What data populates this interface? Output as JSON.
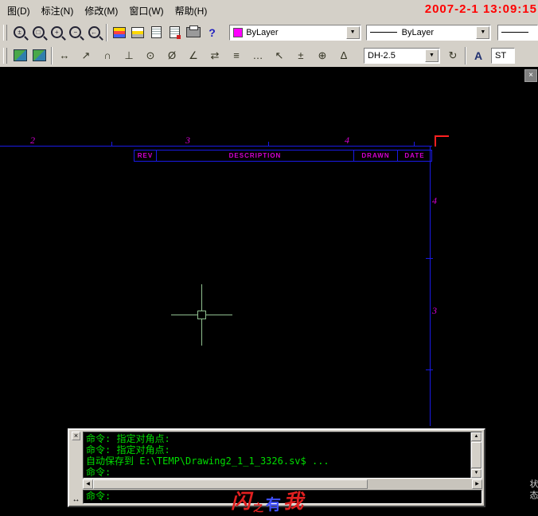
{
  "app": {
    "clock": "2007-2-1 13:09:15"
  },
  "menubar": {
    "items": [
      "图(D)",
      "标注(N)",
      "修改(M)",
      "窗口(W)",
      "帮助(H)"
    ]
  },
  "toolbar_standard": {
    "icons": [
      {
        "name": "zoom-realtime-icon",
        "glyph": "±"
      },
      {
        "name": "zoom-window-icon",
        "glyph": "□"
      },
      {
        "name": "zoom-in-icon",
        "glyph": "+"
      },
      {
        "name": "zoom-out-icon",
        "glyph": "−"
      },
      {
        "name": "zoom-previous-icon",
        "glyph": "←"
      },
      {
        "name": "layer-properties-icon",
        "glyph": ""
      },
      {
        "name": "layers-list-icon",
        "glyph": ""
      },
      {
        "name": "object-properties-icon",
        "glyph": ""
      },
      {
        "name": "match-properties-icon",
        "glyph": ""
      },
      {
        "name": "print-icon",
        "glyph": ""
      },
      {
        "name": "help-icon",
        "glyph": "?"
      }
    ],
    "color_combo": {
      "value": "ByLayer",
      "swatch_color": "#ff00ff"
    },
    "linetype_combo": {
      "value": "ByLayer"
    },
    "lineweight_combo": {
      "value": ""
    },
    "dropdown_arrow": "▼"
  },
  "toolbar_dimension": {
    "view_icons": [
      {
        "name": "sw-isometric-view-icon"
      },
      {
        "name": "se-isometric-view-icon"
      }
    ],
    "icons": [
      {
        "name": "linear-dimension-icon",
        "glyph": "↔"
      },
      {
        "name": "aligned-dimension-icon",
        "glyph": "↗"
      },
      {
        "name": "arc-length-dimension-icon",
        "glyph": "∩"
      },
      {
        "name": "ordinate-dimension-icon",
        "glyph": "⊥"
      },
      {
        "name": "radius-dimension-icon",
        "glyph": "⊙"
      },
      {
        "name": "diameter-dimension-icon",
        "glyph": "Ø"
      },
      {
        "name": "angular-dimension-icon",
        "glyph": "∠"
      },
      {
        "name": "quick-dimension-icon",
        "glyph": "⇄"
      },
      {
        "name": "baseline-dimension-icon",
        "glyph": "≡"
      },
      {
        "name": "continue-dimension-icon",
        "glyph": "…"
      },
      {
        "name": "quick-leader-icon",
        "glyph": "↖"
      },
      {
        "name": "tolerance-icon",
        "glyph": "±"
      },
      {
        "name": "center-mark-icon",
        "glyph": "⊕"
      },
      {
        "name": "dimension-edit-icon",
        "glyph": "Δ"
      },
      {
        "name": "dimension-update-icon",
        "glyph": "↻"
      }
    ],
    "dim_style_combo": {
      "value": "DH-2.5"
    },
    "text_style_icon_glyph": "A",
    "text_style_combo": {
      "value": "ST"
    },
    "dropdown_arrow": "▼"
  },
  "drawing": {
    "zone_top": [
      "2",
      "3",
      "4"
    ],
    "zone_right": [
      "4",
      "3"
    ],
    "title_block_headers": [
      "REV",
      "DESCRIPTION",
      "DRAWN",
      "DATE"
    ],
    "colors": {
      "border_line": "#1a1ae6",
      "zone_label": "#d400d4",
      "crosshair": "#90c090",
      "corner_mark": "#ff2020",
      "background": "#000000"
    },
    "close_label": "×"
  },
  "command_window": {
    "history": [
      "命令: 指定对角点:",
      "命令: 指定对角点:",
      "自动保存到 E:\\TEMP\\Drawing2_1_1_3326.sv$ ...",
      "命令:"
    ],
    "prompt": "命令:",
    "close_label": "×",
    "grip_label": "↔",
    "scroll_up": "▲",
    "scroll_down": "▼",
    "scroll_left": "◀",
    "scroll_right": "▶"
  },
  "watermark": {
    "chars": [
      "闪",
      "之",
      "有",
      "我"
    ]
  },
  "side_panel": {
    "label": "状态"
  }
}
